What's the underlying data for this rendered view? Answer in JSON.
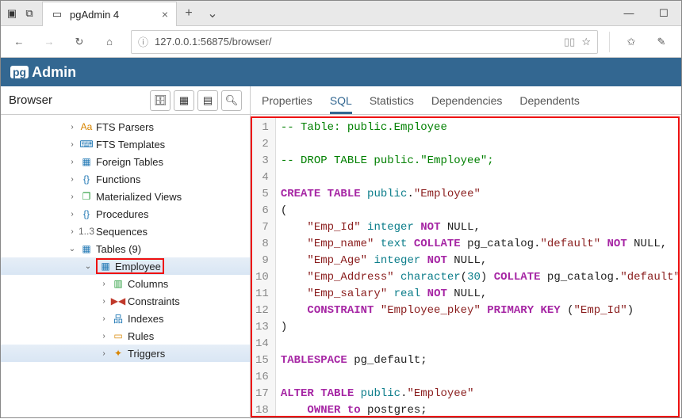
{
  "titlebar": {
    "tab_title": "pgAdmin 4"
  },
  "urlbar": {
    "url": "127.0.0.1:56875/browser/"
  },
  "app": {
    "logo_badge": "pg",
    "logo_text": "Admin"
  },
  "sidebar": {
    "title": "Browser",
    "tree": [
      {
        "indent": 84,
        "caret": "›",
        "icon": "Aa",
        "icon_cls": "ic-orange",
        "label": "FTS Parsers"
      },
      {
        "indent": 84,
        "caret": "›",
        "icon": "⌨",
        "icon_cls": "ic-blue",
        "label": "FTS Templates"
      },
      {
        "indent": 84,
        "caret": "›",
        "icon": "▦",
        "icon_cls": "ic-blue",
        "label": "Foreign Tables"
      },
      {
        "indent": 84,
        "caret": "›",
        "icon": "{}",
        "icon_cls": "ic-blue",
        "label": "Functions"
      },
      {
        "indent": 84,
        "caret": "›",
        "icon": "❐",
        "icon_cls": "ic-green",
        "label": "Materialized Views"
      },
      {
        "indent": 84,
        "caret": "›",
        "icon": "{}",
        "icon_cls": "ic-blue",
        "label": "Procedures"
      },
      {
        "indent": 84,
        "caret": "›",
        "icon": "1..3",
        "icon_cls": "ic-gray",
        "label": "Sequences"
      },
      {
        "indent": 84,
        "caret": "⌄",
        "icon": "▦",
        "icon_cls": "ic-blue",
        "label": "Tables (9)"
      },
      {
        "indent": 104,
        "caret": "⌄",
        "icon": "▦",
        "icon_cls": "ic-blue",
        "label": "Employee",
        "selected": true,
        "highlight": true
      },
      {
        "indent": 124,
        "caret": "›",
        "icon": "▥",
        "icon_cls": "ic-green",
        "label": "Columns"
      },
      {
        "indent": 124,
        "caret": "›",
        "icon": "▶◀",
        "icon_cls": "ic-red",
        "label": "Constraints"
      },
      {
        "indent": 124,
        "caret": "›",
        "icon": "品",
        "icon_cls": "ic-blue",
        "label": "Indexes"
      },
      {
        "indent": 124,
        "caret": "›",
        "icon": "▭",
        "icon_cls": "ic-orange",
        "label": "Rules"
      },
      {
        "indent": 124,
        "caret": "›",
        "icon": "✦",
        "icon_cls": "ic-orange",
        "label": "Triggers",
        "selected": true
      }
    ]
  },
  "content_tabs": [
    {
      "label": "Properties"
    },
    {
      "label": "SQL",
      "active": true
    },
    {
      "label": "Statistics"
    },
    {
      "label": "Dependencies"
    },
    {
      "label": "Dependents"
    }
  ],
  "sql": {
    "lines": [
      [
        {
          "cls": "cmt",
          "t": "-- Table: public.Employee"
        }
      ],
      [
        {
          "cls": "",
          "t": ""
        }
      ],
      [
        {
          "cls": "cmt",
          "t": "-- DROP TABLE public.\"Employee\";"
        }
      ],
      [
        {
          "cls": "",
          "t": ""
        }
      ],
      [
        {
          "cls": "kw-purple",
          "t": "CREATE TABLE"
        },
        {
          "cls": "",
          "t": " "
        },
        {
          "cls": "kw-teal",
          "t": "public"
        },
        {
          "cls": "",
          "t": "."
        },
        {
          "cls": "str",
          "t": "\"Employee\""
        }
      ],
      [
        {
          "cls": "",
          "t": "("
        }
      ],
      [
        {
          "cls": "",
          "t": "    "
        },
        {
          "cls": "str",
          "t": "\"Emp_Id\""
        },
        {
          "cls": "",
          "t": " "
        },
        {
          "cls": "kw-teal",
          "t": "integer"
        },
        {
          "cls": "",
          "t": " "
        },
        {
          "cls": "kw-purple",
          "t": "NOT"
        },
        {
          "cls": "",
          "t": " NULL,"
        }
      ],
      [
        {
          "cls": "",
          "t": "    "
        },
        {
          "cls": "str",
          "t": "\"Emp_name\""
        },
        {
          "cls": "",
          "t": " "
        },
        {
          "cls": "kw-teal",
          "t": "text"
        },
        {
          "cls": "",
          "t": " "
        },
        {
          "cls": "kw-purple",
          "t": "COLLATE"
        },
        {
          "cls": "",
          "t": " pg_catalog."
        },
        {
          "cls": "str",
          "t": "\"default\""
        },
        {
          "cls": "",
          "t": " "
        },
        {
          "cls": "kw-purple",
          "t": "NOT"
        },
        {
          "cls": "",
          "t": " NULL,"
        }
      ],
      [
        {
          "cls": "",
          "t": "    "
        },
        {
          "cls": "str",
          "t": "\"Emp_Age\""
        },
        {
          "cls": "",
          "t": " "
        },
        {
          "cls": "kw-teal",
          "t": "integer"
        },
        {
          "cls": "",
          "t": " "
        },
        {
          "cls": "kw-purple",
          "t": "NOT"
        },
        {
          "cls": "",
          "t": " NULL,"
        }
      ],
      [
        {
          "cls": "",
          "t": "    "
        },
        {
          "cls": "str",
          "t": "\"Emp_Address\""
        },
        {
          "cls": "",
          "t": " "
        },
        {
          "cls": "kw-teal",
          "t": "character"
        },
        {
          "cls": "",
          "t": "("
        },
        {
          "cls": "num-teal",
          "t": "30"
        },
        {
          "cls": "",
          "t": ") "
        },
        {
          "cls": "kw-purple",
          "t": "COLLATE"
        },
        {
          "cls": "",
          "t": " pg_catalog."
        },
        {
          "cls": "str",
          "t": "\"default\""
        },
        {
          "cls": "",
          "t": ","
        }
      ],
      [
        {
          "cls": "",
          "t": "    "
        },
        {
          "cls": "str",
          "t": "\"Emp_salary\""
        },
        {
          "cls": "",
          "t": " "
        },
        {
          "cls": "kw-teal",
          "t": "real"
        },
        {
          "cls": "",
          "t": " "
        },
        {
          "cls": "kw-purple",
          "t": "NOT"
        },
        {
          "cls": "",
          "t": " NULL,"
        }
      ],
      [
        {
          "cls": "",
          "t": "    "
        },
        {
          "cls": "kw-purple",
          "t": "CONSTRAINT"
        },
        {
          "cls": "",
          "t": " "
        },
        {
          "cls": "str",
          "t": "\"Employee_pkey\""
        },
        {
          "cls": "",
          "t": " "
        },
        {
          "cls": "kw-purple",
          "t": "PRIMARY KEY"
        },
        {
          "cls": "",
          "t": " ("
        },
        {
          "cls": "str",
          "t": "\"Emp_Id\""
        },
        {
          "cls": "",
          "t": ")"
        }
      ],
      [
        {
          "cls": "",
          "t": ")"
        }
      ],
      [
        {
          "cls": "",
          "t": ""
        }
      ],
      [
        {
          "cls": "kw-purple",
          "t": "TABLESPACE"
        },
        {
          "cls": "",
          "t": " pg_default;"
        }
      ],
      [
        {
          "cls": "",
          "t": ""
        }
      ],
      [
        {
          "cls": "kw-purple",
          "t": "ALTER TABLE"
        },
        {
          "cls": "",
          "t": " "
        },
        {
          "cls": "kw-teal",
          "t": "public"
        },
        {
          "cls": "",
          "t": "."
        },
        {
          "cls": "str",
          "t": "\"Employee\""
        }
      ],
      [
        {
          "cls": "",
          "t": "    "
        },
        {
          "cls": "kw-purple",
          "t": "OWNER to"
        },
        {
          "cls": "",
          "t": " postgres;"
        }
      ]
    ]
  }
}
